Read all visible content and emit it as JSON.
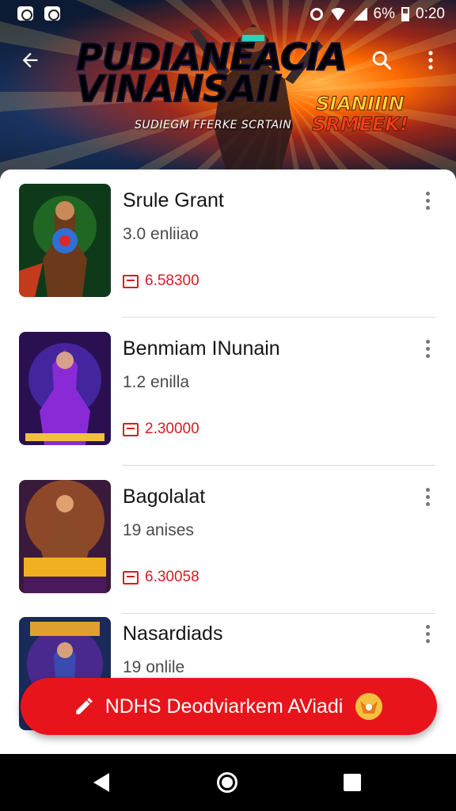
{
  "status_bar": {
    "battery_text": "6%",
    "time": "0:20"
  },
  "hero": {
    "title": "PUDIANEACIA VINANSAII",
    "subtitle": "SUDIEGM FFERKE SCRTAIN",
    "side_line1": "SIANIIIN",
    "side_line2": "SRMEEK!"
  },
  "toolbar": {
    "back_icon": "arrow-left-icon",
    "search_icon": "search-icon",
    "more_icon": "more-vert-icon"
  },
  "items": [
    {
      "title": "Srule Grant",
      "meta": "3.0 enliiao",
      "price": "6.58300",
      "palette": [
        "#1a5a2a",
        "#c43a1c",
        "#2f6fd6"
      ]
    },
    {
      "title": "Benmiam INunain",
      "meta": "1.2 enilla",
      "price": "2.30000",
      "palette": [
        "#3b1a6a",
        "#9b2bd6",
        "#2a5ad6"
      ]
    },
    {
      "title": "Bagolalat",
      "meta": "19 anises",
      "price": "6.30058",
      "palette": [
        "#5a1a3a",
        "#e08a1a",
        "#7a3ac0"
      ]
    },
    {
      "title": "Nasardiads",
      "meta": "19 onlile",
      "price": "",
      "palette": [
        "#1a3a6a",
        "#d6a02a",
        "#6a2ab0"
      ]
    }
  ],
  "cta": {
    "label": "NDHS Deodviarkem AViadi",
    "icon": "pencil-icon",
    "badge_icon": "badge-icon",
    "bg_color": "#e8141b"
  },
  "navbar": {
    "back": "nav-back-icon",
    "home": "nav-home-icon",
    "recent": "nav-recent-icon"
  }
}
